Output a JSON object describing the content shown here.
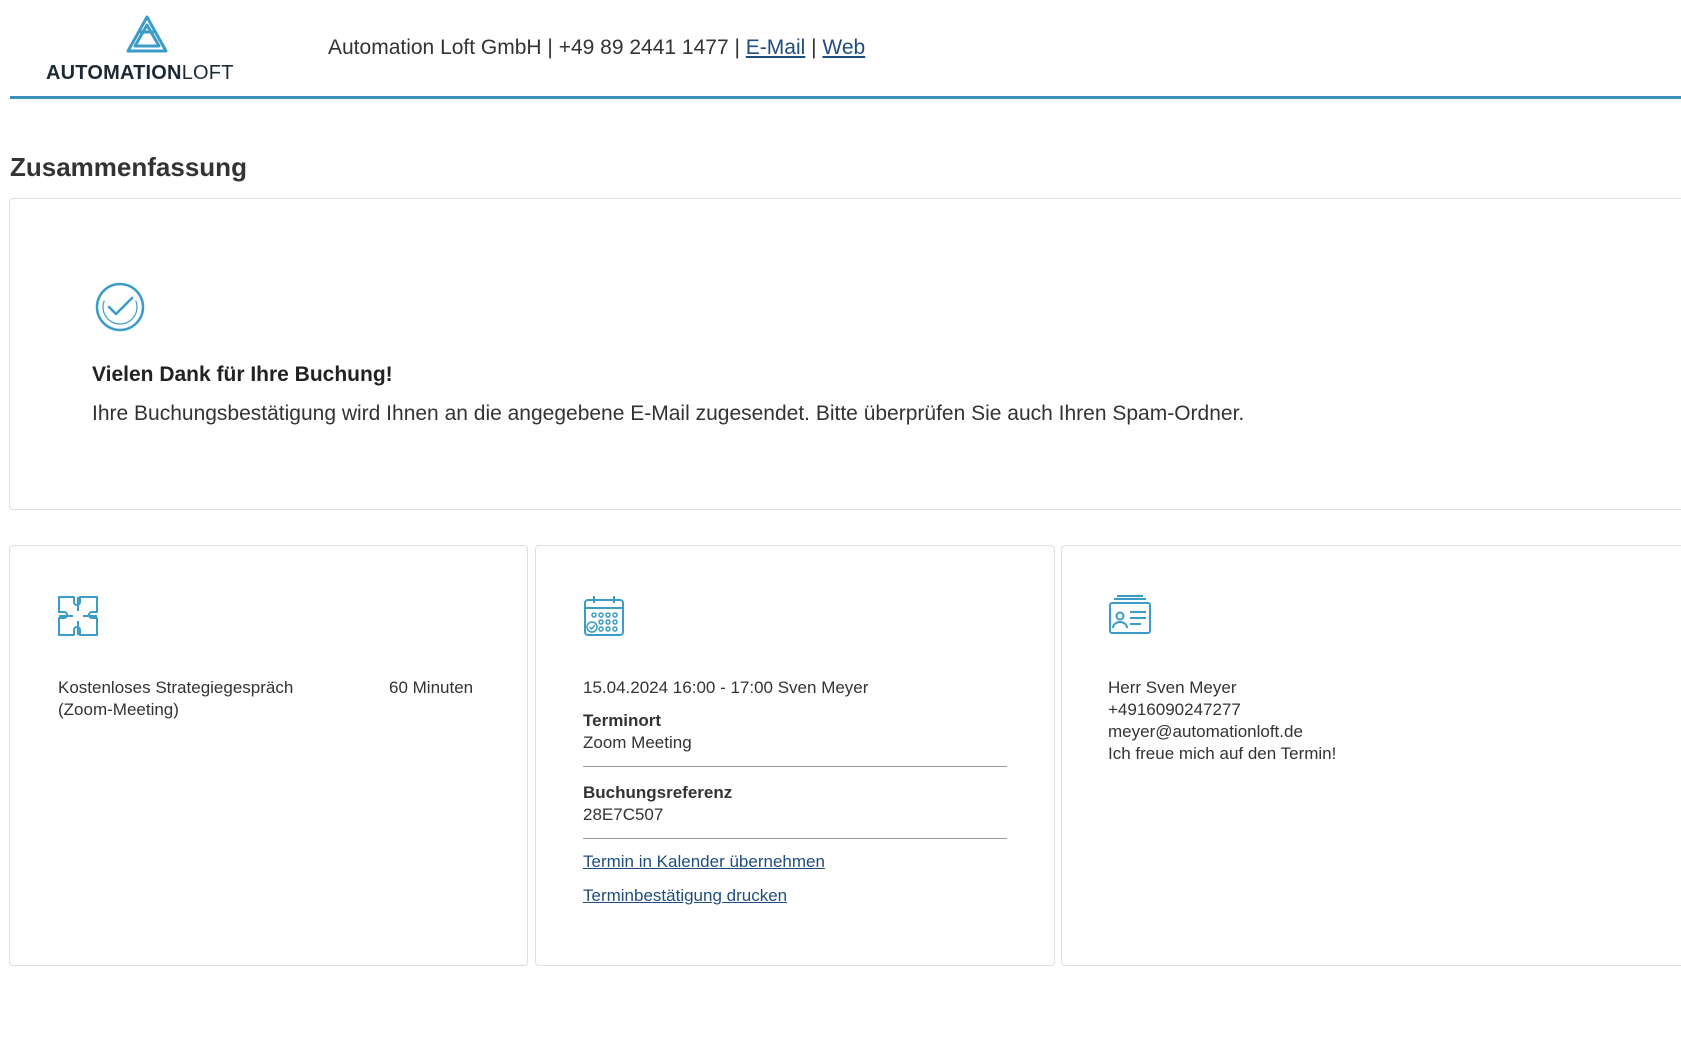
{
  "header": {
    "logo_bold": "AUTOMATION",
    "logo_light": "LOFT",
    "contact_prefix": "Automation Loft GmbH | +49 89 2441 1477 | ",
    "email_link": "E-Mail",
    "separator": " | ",
    "web_link": "Web"
  },
  "summary": {
    "title": "Zusammenfassung",
    "thanks": "Vielen Dank für Ihre Buchung!",
    "note": "Ihre Buchungsbestätigung wird Ihnen an die angegebene E-Mail zugesendet. Bitte überprüfen Sie auch Ihren Spam-Ordner."
  },
  "service": {
    "name": "Kostenloses Strategiegespräch (Zoom-Meeting)",
    "duration": "60 Minuten"
  },
  "appointment": {
    "datetime": "15.04.2024 16:00 - 17:00 Sven Meyer",
    "location_label": "Terminort",
    "location_value": "Zoom Meeting",
    "reference_label": "Buchungsreferenz",
    "reference_value": "28E7C507",
    "calendar_link": "Termin in Kalender übernehmen",
    "print_link": "Terminbestätigung drucken"
  },
  "customer": {
    "name": "Herr Sven Meyer",
    "phone": "+4916090247277",
    "email": "meyer@automationloft.de",
    "message": "Ich freue mich auf den Termin!"
  },
  "colors": {
    "accent": "#3b8fbf",
    "icon": "#3a9cc7",
    "link": "#1f4d80"
  }
}
